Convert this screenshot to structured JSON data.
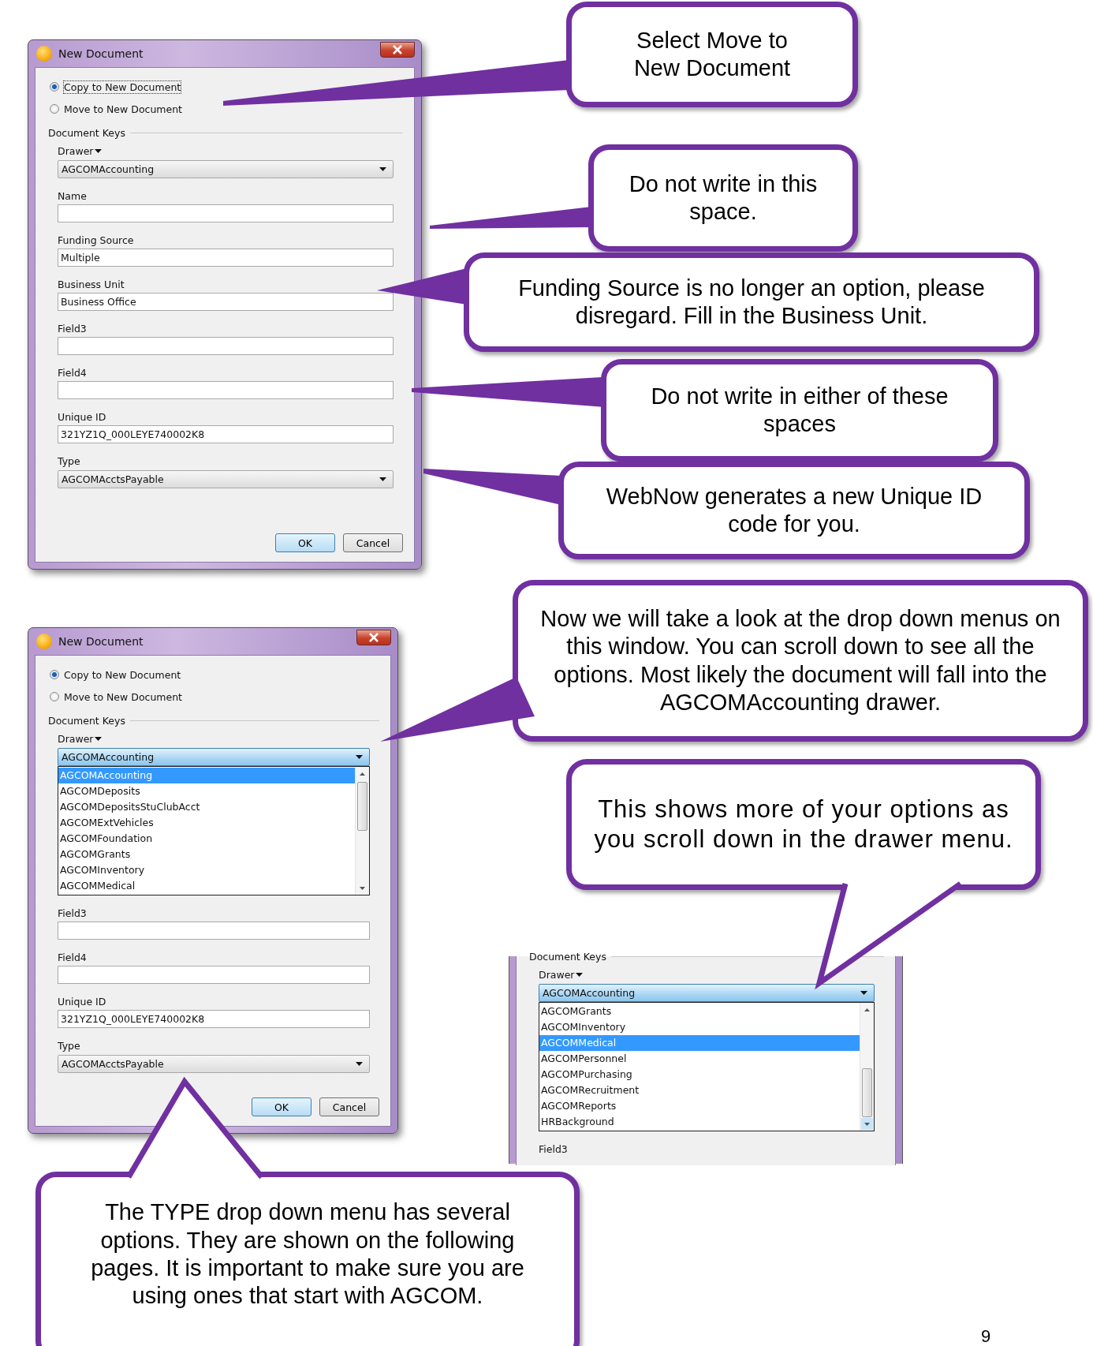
{
  "dialogs": [
    {
      "kind": "full",
      "title": "New Document",
      "options": [
        {
          "label": "Copy to New Document",
          "selected": true
        },
        {
          "label": "Move to New Document",
          "selected": false
        }
      ],
      "group_label": "Document Keys",
      "drawer": {
        "label": "Drawer",
        "value": "AGCOMAccounting",
        "open": false
      },
      "fields": [
        {
          "kind": "text",
          "label": "Name"
        },
        {
          "kind": "text",
          "label": "Funding Source",
          "value": "Multiple"
        },
        {
          "kind": "text",
          "label": "Business Unit",
          "value": "Business Office"
        },
        {
          "kind": "text",
          "label": "Field3"
        },
        {
          "kind": "text",
          "label": "Field4"
        },
        {
          "kind": "text",
          "label": "Unique ID",
          "value": "321YZ1Q_000LEYE740002K8"
        },
        {
          "kind": "dropdown",
          "label": "Type",
          "value": "AGCOMAcctsPayable"
        }
      ],
      "buttons": [
        "OK",
        "Cancel"
      ]
    },
    {
      "kind": "full",
      "title": "New Document",
      "options": [
        {
          "label": "Copy to New Document",
          "selected": true
        },
        {
          "label": "Move to New Document",
          "selected": false
        }
      ],
      "group_label": "Document Keys",
      "drawer": {
        "label": "Drawer",
        "value": "AGCOMAccounting",
        "open": true,
        "items": [
          {
            "label": "AGCOMAccounting",
            "selected": true
          },
          {
            "label": "AGCOMDeposits",
            "selected": false
          },
          {
            "label": "AGCOMDepositsStuClubAcct",
            "selected": false
          },
          {
            "label": "AGCOMExtVehicles",
            "selected": false
          },
          {
            "label": "AGCOMFoundation",
            "selected": false
          },
          {
            "label": "AGCOMGrants",
            "selected": false
          },
          {
            "label": "AGCOMInventory",
            "selected": false
          },
          {
            "label": "AGCOMMedical",
            "selected": false
          }
        ]
      },
      "fields": [
        {
          "kind": "text",
          "label": "Field3"
        },
        {
          "kind": "text",
          "label": "Field4"
        },
        {
          "kind": "text",
          "label": "Unique ID",
          "value": "321YZ1Q_000LEYE740002K8"
        },
        {
          "kind": "dropdown",
          "label": "Type",
          "value": "AGCOMAcctsPayable"
        }
      ],
      "buttons": [
        "OK",
        "Cancel"
      ]
    },
    {
      "kind": "crop",
      "group_label": "Document Keys",
      "drawer": {
        "label": "Drawer",
        "value": "AGCOMAccounting",
        "open": true,
        "items": [
          {
            "label": "AGCOMGrants",
            "selected": false
          },
          {
            "label": "AGCOMInventory",
            "selected": false
          },
          {
            "label": "AGCOMMedical",
            "selected": true
          },
          {
            "label": "AGCOMPersonnel",
            "selected": false
          },
          {
            "label": "AGCOMPurchasing",
            "selected": false
          },
          {
            "label": "AGCOMRecruitment",
            "selected": false
          },
          {
            "label": "AGCOMReports",
            "selected": false
          },
          {
            "label": "HRBackground",
            "selected": false
          }
        ]
      },
      "fields": [
        {
          "kind": "label",
          "label": "Field3"
        }
      ]
    }
  ],
  "callouts": [
    {
      "text": "Select Move to New Document"
    },
    {
      "text": "Do not write in this space."
    },
    {
      "text": "Funding Source is no longer an option, please disregard. Fill in the Business Unit."
    },
    {
      "text": "Do not write in either of these spaces"
    },
    {
      "text": "WebNow generates a new Unique ID code for you."
    },
    {
      "text": "Now we will take a look at the drop down menus on this window. You can scroll down to see all the options. Most likely the document will fall into the AGCOMAccounting drawer."
    },
    {
      "text": "This shows more of your options as you scroll down in the drawer menu."
    },
    {
      "text": "The TYPE drop down menu has several options. They are shown on the following pages. It is important to make sure you are using ones that start with AGCOM."
    }
  ],
  "page_number": "9"
}
